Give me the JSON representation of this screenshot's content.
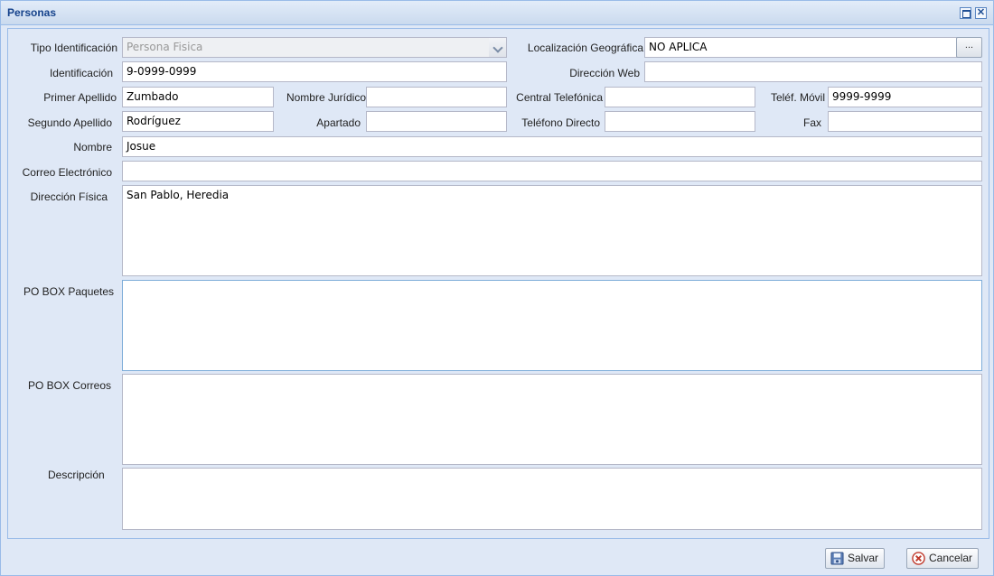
{
  "window": {
    "title": "Personas"
  },
  "form": {
    "tipo_identificacion": {
      "label": "Tipo Identificación",
      "value": "Persona Fisica"
    },
    "identificacion": {
      "label": "Identificación",
      "value": "9-0999-0999"
    },
    "primer_apellido": {
      "label": "Primer Apellido",
      "value": "Zumbado"
    },
    "segundo_apellido": {
      "label": "Segundo Apellido",
      "value": "Rodríguez"
    },
    "nombre": {
      "label": "Nombre",
      "value": "Josue"
    },
    "correo": {
      "label": "Correo Electrónico",
      "value": ""
    },
    "direccion_fisica": {
      "label": "Dirección Física",
      "value": "San Pablo, Heredia"
    },
    "po_box_paquetes": {
      "label": "PO BOX Paquetes",
      "value": ""
    },
    "po_box_correos": {
      "label": "PO BOX Correos",
      "value": ""
    },
    "descripcion": {
      "label": "Descripción",
      "value": ""
    },
    "nombre_juridico": {
      "label": "Nombre Jurídico",
      "value": ""
    },
    "apartado": {
      "label": "Apartado",
      "value": ""
    },
    "localizacion": {
      "label": "Localización Geográfica",
      "value": "NO APLICA",
      "button": "..."
    },
    "direccion_web": {
      "label": "Dirección Web",
      "value": ""
    },
    "central_telefonica": {
      "label": "Central Telefónica",
      "value": ""
    },
    "telefono_directo": {
      "label": "Teléfono Directo",
      "value": ""
    },
    "telef_movil": {
      "label": "Teléf. Móvil",
      "value": "9999-9999"
    },
    "fax": {
      "label": "Fax",
      "value": ""
    }
  },
  "buttons": {
    "save": "Salvar",
    "cancel": "Cancelar"
  },
  "icons": {
    "maximize": "maximize-icon",
    "close": "close-icon",
    "save": "floppy-disk-icon",
    "cancel": "cancel-icon"
  }
}
